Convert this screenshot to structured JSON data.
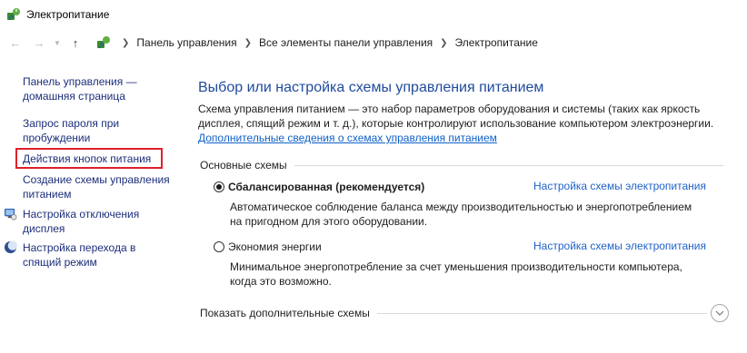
{
  "window": {
    "title": "Электропитание"
  },
  "address": {
    "breadcrumbs": [
      "Панель управления",
      "Все элементы панели управления",
      "Электропитание"
    ]
  },
  "sidebar": {
    "items": [
      {
        "label_line1": "Панель управления —",
        "label_line2": "домашняя страница"
      },
      {
        "label_line1": "Запрос пароля при",
        "label_line2": "пробуждении"
      },
      {
        "label_line1": "Действия кнопок питания"
      },
      {
        "label_line1": "Создание схемы управления",
        "label_line2": "питанием"
      },
      {
        "label_line1": "Настройка отключения",
        "label_line2": "дисплея"
      },
      {
        "label_line1": "Настройка перехода в",
        "label_line2": "спящий режим"
      }
    ]
  },
  "main": {
    "heading": "Выбор или настройка схемы управления питанием",
    "desc_line1": "Схема управления питанием — это набор параметров оборудования и системы (таких как яркость",
    "desc_line2": "дисплея, спящий режим и т. д.), которые контролируют использование компьютером электроэнергии.",
    "more_link": "Дополнительные сведения о схемах управления питанием",
    "section_label": "Основные схемы",
    "plans": [
      {
        "name": "Сбалансированная (рекомендуется)",
        "settings_link": "Настройка схемы электропитания",
        "desc_line1": "Автоматическое соблюдение баланса между производительностью и энергопотреблением",
        "desc_line2": "на пригодном для этого оборудовании.",
        "selected": true
      },
      {
        "name": "Экономия энергии",
        "settings_link": "Настройка схемы электропитания",
        "desc_line1": "Минимальное энергопотребление за счет уменьшения производительности компьютера,",
        "desc_line2": "когда это возможно.",
        "selected": false
      }
    ],
    "show_more_label": "Показать дополнительные схемы"
  },
  "colors": {
    "sidebar_link": "#1c2e7a",
    "heading": "#1f4b9c",
    "link": "#1f62c8",
    "highlight": "#e0202a"
  }
}
